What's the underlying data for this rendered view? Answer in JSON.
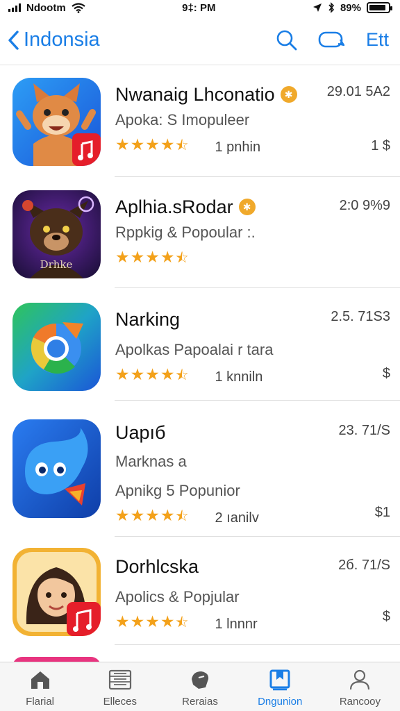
{
  "status_bar": {
    "carrier": "Ndootm",
    "time": "9‡: PM",
    "battery": "89%",
    "battery_level": 0.89
  },
  "nav": {
    "back_label": "Indonsia",
    "edit_label": "Ett",
    "back_icon": "chevron-left-icon",
    "search_icon": "search-icon",
    "chat_icon": "chat-bubble-icon"
  },
  "apps": [
    {
      "title": "Nwanaig Lhconatio",
      "has_badge": true,
      "subtitle": "Apoka: S Imopuleer",
      "rating": 4.5,
      "count": "1 pnhin",
      "value": "29.01 5A2",
      "price": "1 $"
    },
    {
      "title": "Aplhia.sRodar",
      "has_badge": true,
      "subtitle": "Rppkig & Popoular :.",
      "rating": 4.5,
      "count": "",
      "value": "2:0 9%9",
      "price": "",
      "icon_text": "Drhke"
    },
    {
      "title": "Narking",
      "has_badge": false,
      "subtitle": "Apolkas Papoalai r tara",
      "rating": 4.5,
      "count": "1 knniln",
      "value": "2.5. 71S3",
      "price": "$"
    },
    {
      "title": "Uapıб",
      "has_badge": false,
      "subtitle": "Marknas a",
      "subtitle2": "Apnikg 5 Popunior",
      "rating": 4.5,
      "count": "2 ıanilv",
      "value": "23. 71/S",
      "price": "$1"
    },
    {
      "title": "Dorhlcska",
      "has_badge": false,
      "subtitle": "Apolics & Popjular",
      "rating": 4.5,
      "count": "1 lnnnr",
      "value": "2б. 71/S",
      "price": "$"
    }
  ],
  "tabs": [
    {
      "label": "Flarial",
      "icon": "home-icon",
      "active": false
    },
    {
      "label": "Elleces",
      "icon": "list-icon",
      "active": false
    },
    {
      "label": "Reraias",
      "icon": "games-icon",
      "active": false
    },
    {
      "label": "Dngunion",
      "icon": "bookmark-icon",
      "active": true
    },
    {
      "label": "Rancooy",
      "icon": "person-icon",
      "active": false
    }
  ],
  "colors": {
    "accent": "#1a7ee6",
    "star": "#f3a11a",
    "badge": "#f0a92b"
  }
}
